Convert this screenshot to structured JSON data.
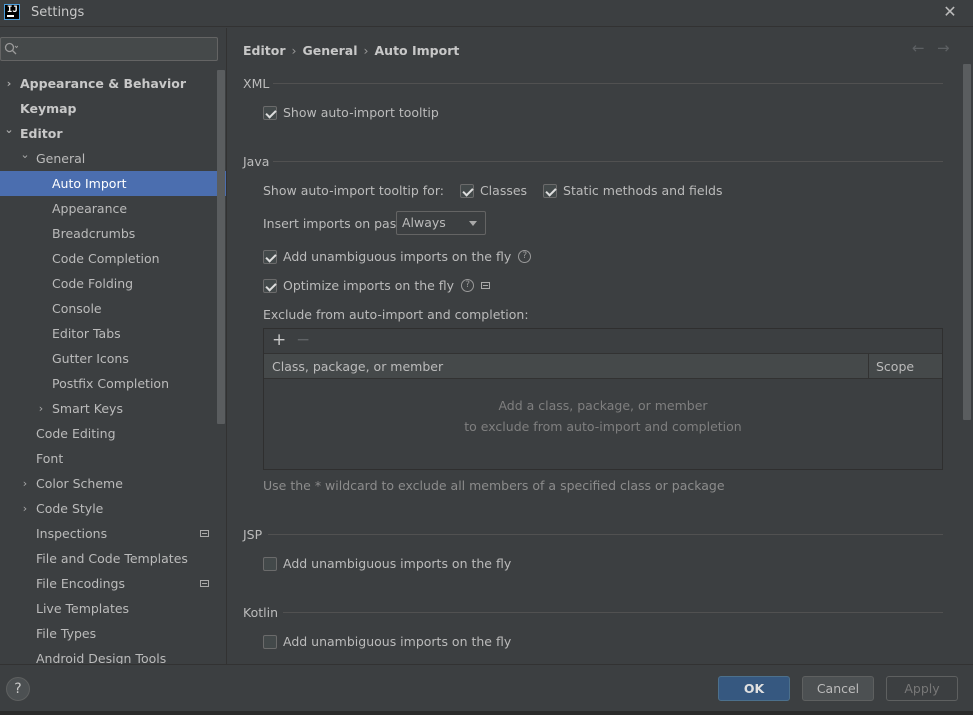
{
  "window": {
    "title": "Settings",
    "logo_text": "IJ"
  },
  "search": {
    "value": "",
    "placeholder": ""
  },
  "sidebar": {
    "items": [
      {
        "label": "Appearance & Behavior",
        "level": 0,
        "chevron": "collapsed",
        "bold": true
      },
      {
        "label": "Keymap",
        "level": 0,
        "chevron": "none",
        "bold": true
      },
      {
        "label": "Editor",
        "level": 0,
        "chevron": "expanded",
        "bold": true
      },
      {
        "label": "General",
        "level": 1,
        "chevron": "expanded"
      },
      {
        "label": "Auto Import",
        "level": 2,
        "chevron": "none",
        "selected": true
      },
      {
        "label": "Appearance",
        "level": 2,
        "chevron": "none"
      },
      {
        "label": "Breadcrumbs",
        "level": 2,
        "chevron": "none"
      },
      {
        "label": "Code Completion",
        "level": 2,
        "chevron": "none"
      },
      {
        "label": "Code Folding",
        "level": 2,
        "chevron": "none"
      },
      {
        "label": "Console",
        "level": 2,
        "chevron": "none"
      },
      {
        "label": "Editor Tabs",
        "level": 2,
        "chevron": "none"
      },
      {
        "label": "Gutter Icons",
        "level": 2,
        "chevron": "none"
      },
      {
        "label": "Postfix Completion",
        "level": 2,
        "chevron": "none"
      },
      {
        "label": "Smart Keys",
        "level": 2,
        "chevron": "collapsed"
      },
      {
        "label": "Code Editing",
        "level": 1,
        "chevron": "none"
      },
      {
        "label": "Font",
        "level": 1,
        "chevron": "none"
      },
      {
        "label": "Color Scheme",
        "level": 1,
        "chevron": "collapsed"
      },
      {
        "label": "Code Style",
        "level": 1,
        "chevron": "collapsed"
      },
      {
        "label": "Inspections",
        "level": 1,
        "chevron": "none",
        "badge": true
      },
      {
        "label": "File and Code Templates",
        "level": 1,
        "chevron": "none"
      },
      {
        "label": "File Encodings",
        "level": 1,
        "chevron": "none",
        "badge": true
      },
      {
        "label": "Live Templates",
        "level": 1,
        "chevron": "none"
      },
      {
        "label": "File Types",
        "level": 1,
        "chevron": "none"
      },
      {
        "label": "Android Design Tools",
        "level": 1,
        "chevron": "none"
      }
    ]
  },
  "breadcrumb": {
    "part1": "Editor",
    "part2": "General",
    "part3": "Auto Import",
    "separator": "›"
  },
  "nav": {
    "back": "←",
    "forward": "→"
  },
  "xml": {
    "title": "XML",
    "show_tooltip": {
      "label": "Show auto-import tooltip",
      "checked": true
    }
  },
  "java": {
    "title": "Java",
    "tooltip_for_label": "Show auto-import tooltip for:",
    "classes": {
      "label": "Classes",
      "checked": true
    },
    "static_methods": {
      "label": "Static methods and fields",
      "checked": true
    },
    "insert_imports_label": "Insert imports on paste:",
    "insert_imports_value": "Always",
    "add_unambiguous": {
      "label": "Add unambiguous imports on the fly",
      "checked": true
    },
    "optimize_imports": {
      "label": "Optimize imports on the fly",
      "checked": true
    },
    "exclude_label": "Exclude from auto-import and completion:",
    "table": {
      "add": "+",
      "remove": "−",
      "columns": [
        "Class, package, or member",
        "Scope"
      ],
      "empty_line1": "Add a class, package, or member",
      "empty_line2": "to exclude from auto-import and completion"
    },
    "hint": "Use the * wildcard to exclude all members of a specified class or package"
  },
  "jsp": {
    "title": "JSP",
    "add_unambiguous": {
      "label": "Add unambiguous imports on the fly",
      "checked": false
    }
  },
  "kotlin": {
    "title": "Kotlin",
    "add_unambiguous": {
      "label": "Add unambiguous imports on the fly",
      "checked": false
    }
  },
  "footer": {
    "help": "?",
    "ok": "OK",
    "cancel": "Cancel",
    "apply": "Apply"
  },
  "colors": {
    "background": "#3c3f41",
    "selection": "#4b6eaf",
    "primary_button": "#365880"
  }
}
